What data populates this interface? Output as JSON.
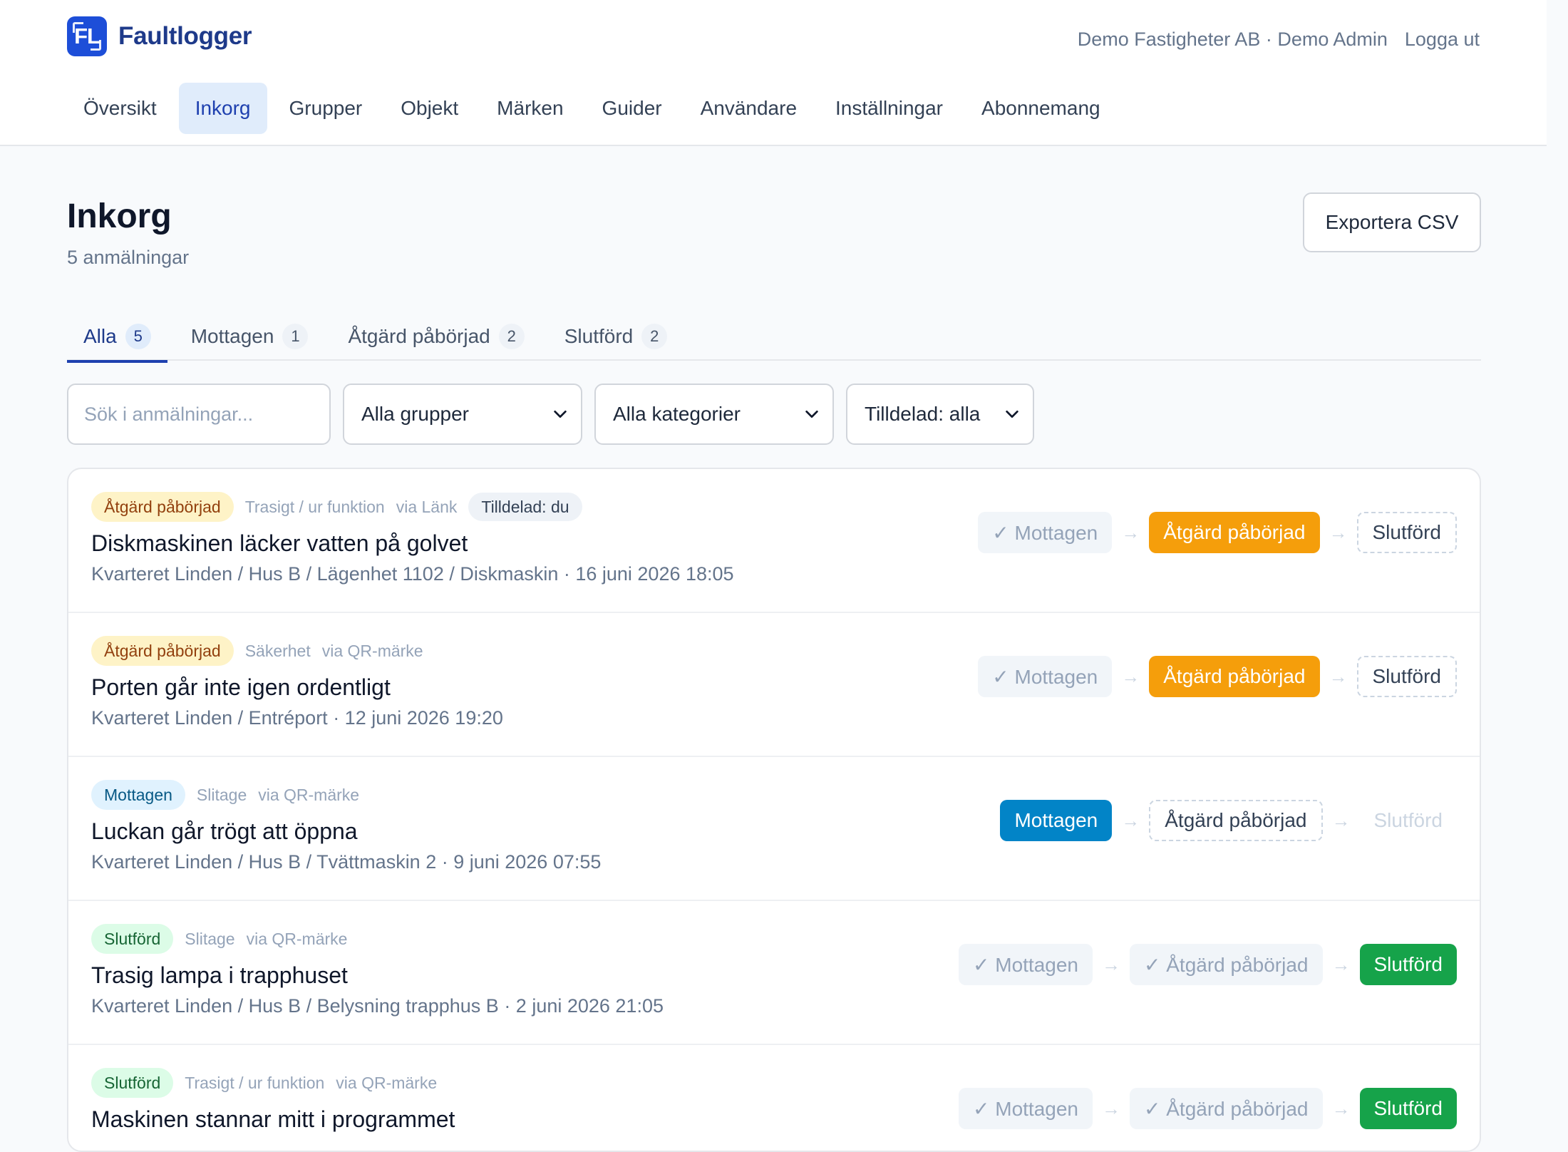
{
  "app": {
    "logo_text": "FL",
    "name": "Faultlogger"
  },
  "account": {
    "org_user": "Demo Fastigheter AB · Demo Admin",
    "logout": "Logga ut"
  },
  "nav": [
    "Översikt",
    "Inkorg",
    "Grupper",
    "Objekt",
    "Märken",
    "Guider",
    "Användare",
    "Inställningar",
    "Abonnemang"
  ],
  "nav_active": "Inkorg",
  "page": {
    "title": "Inkorg",
    "subtitle": "5 anmälningar",
    "export_label": "Exportera CSV"
  },
  "tabs": [
    {
      "label": "Alla",
      "count": "5"
    },
    {
      "label": "Mottagen",
      "count": "1"
    },
    {
      "label": "Åtgärd påbörjad",
      "count": "2"
    },
    {
      "label": "Slutförd",
      "count": "2"
    }
  ],
  "filters": {
    "search_placeholder": "Sök i anmälningar...",
    "group": "Alla grupper",
    "category": "Alla kategorier",
    "assigned": "Tilldelad: alla"
  },
  "tickets": [
    {
      "status": "Åtgärd påbörjad",
      "category": "Trasigt / ur funktion",
      "source": "via Länk",
      "assigned": "Tilldelad: du",
      "title": "Diskmaskinen läcker vatten på golvet",
      "location_time": "Kvarteret Linden / Hus B / Lägenhet 1102 / Diskmaskin · 16 juni 2026 18:05",
      "steps": [
        "✓ Mottagen",
        "Åtgärd påbörjad",
        "Slutförd"
      ]
    },
    {
      "status": "Åtgärd påbörjad",
      "category": "Säkerhet",
      "source": "via QR-märke",
      "title": "Porten går inte igen ordentligt",
      "location_time": "Kvarteret Linden / Entréport · 12 juni 2026 19:20",
      "steps": [
        "✓ Mottagen",
        "Åtgärd påbörjad",
        "Slutförd"
      ]
    },
    {
      "status": "Mottagen",
      "category": "Slitage",
      "source": "via QR-märke",
      "title": "Luckan går trögt att öppna",
      "location_time": "Kvarteret Linden / Hus B / Tvättmaskin 2 · 9 juni 2026 07:55",
      "steps": [
        "Mottagen",
        "Åtgärd påbörjad",
        "Slutförd"
      ]
    },
    {
      "status": "Slutförd",
      "category": "Slitage",
      "source": "via QR-märke",
      "title": "Trasig lampa i trapphuset",
      "location_time": "Kvarteret Linden / Hus B / Belysning trapphus B · 2 juni 2026 21:05",
      "steps": [
        "✓ Mottagen",
        "✓ Åtgärd påbörjad",
        "Slutförd"
      ]
    },
    {
      "status": "Slutförd",
      "category": "Trasigt / ur funktion",
      "source": "via QR-märke",
      "title": "Maskinen stannar mitt i programmet",
      "location_time": "",
      "steps": [
        "✓ Mottagen",
        "✓ Åtgärd påbörjad",
        "Slutförd"
      ]
    }
  ],
  "step_arrow": "→",
  "colors": {
    "brand": "#1d4ed8",
    "started": "#f59e0b",
    "received": "#0284c7",
    "done": "#16a34a"
  }
}
